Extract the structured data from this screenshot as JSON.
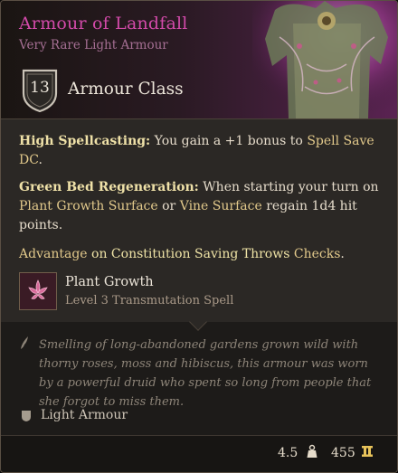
{
  "item": {
    "name": "Armour of Landfall",
    "rarity_type": "Very Rare Light Armour",
    "armour_class_value": "13",
    "armour_class_label": "Armour Class"
  },
  "properties": {
    "p1_title": "High Spellcasting:",
    "p1_text": " You gain a +1 bonus to ",
    "p1_link": "Spell Save DC",
    "p1_end": ".",
    "p2_title": "Green Bed Regeneration:",
    "p2_text": " When starting your turn on ",
    "p2_link1": "Plant Growth Surface",
    "p2_mid": " or ",
    "p2_link2": "Vine Surface",
    "p2_end": " regain 1d4 hit points.",
    "p3_link": "Advantage",
    "p3_mid": " on Constitution Saving Throws ",
    "p3_link2": "Checks",
    "p3_end": "."
  },
  "spell": {
    "name": "Plant Growth",
    "subtitle": "Level 3 Transmutation Spell",
    "icon": "plant-growth-spell-icon"
  },
  "flavor": "Smelling of long-abandoned gardens grown wild with thorny roses, moss and hibiscus, this armour was worn by a powerful druid who spent so long from people that she forgot to miss them.",
  "armour_type": "Light Armour",
  "footer": {
    "weight": "4.5",
    "price": "455"
  },
  "colors": {
    "title": "#d24aa9",
    "subtitle": "#a56f93",
    "keyword": "#efe1a8",
    "background": "#2b2825"
  }
}
